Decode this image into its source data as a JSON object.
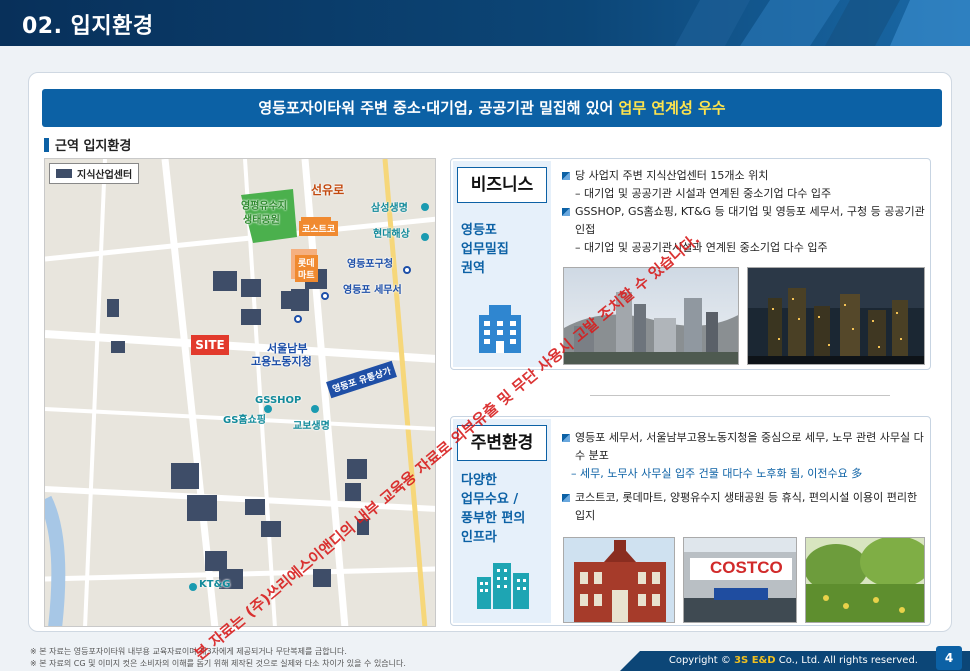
{
  "header": {
    "title": "02. 입지환경"
  },
  "banner": {
    "text_main": "영등포자이타워 주변 중소·대기업, 공공기관 밀집해 있어 ",
    "text_highlight": "업무 연계성 우수"
  },
  "section": {
    "label": "근역 입지환경"
  },
  "map": {
    "legend_label": "지식산업센터",
    "site_label": "SITE",
    "road_label": "영등포 유통상가",
    "labels": [
      {
        "text": "영평유수지",
        "style": "green"
      },
      {
        "text": "생태공원",
        "style": "green"
      },
      {
        "text": "선유로",
        "style": "orange"
      },
      {
        "text": "코스트코",
        "style": "orange"
      },
      {
        "text": "롯데",
        "style": "orange"
      },
      {
        "text": "마트",
        "style": "orange"
      },
      {
        "text": "삼성생명",
        "style": "teal"
      },
      {
        "text": "현대해상",
        "style": "teal"
      },
      {
        "text": "영등포구청",
        "style": "blue"
      },
      {
        "text": "영등포 세무서",
        "style": "blue"
      },
      {
        "text": "서울남부",
        "style": "blue"
      },
      {
        "text": "고용노동지청",
        "style": "blue"
      },
      {
        "text": "GSSHOP",
        "style": "teal"
      },
      {
        "text": "GS홈쇼핑",
        "style": "teal"
      },
      {
        "text": "교보생명",
        "style": "teal"
      },
      {
        "text": "KT&G",
        "style": "teal"
      }
    ]
  },
  "business": {
    "title": "비즈니스",
    "subtitle_lines": [
      "영등포",
      "업무밀집",
      "권역"
    ],
    "bullets": [
      {
        "type": "main",
        "text": "당 사업지 주변 지식산업센터 15개소 위치"
      },
      {
        "type": "sub",
        "text": "– 대기업 및 공공기관 시설과 연계된 중소기업 다수 입주"
      },
      {
        "type": "main",
        "text": "GSSHOP, GS홈쇼핑, KT&G 등 대기업 및 영등포 세무서, 구청 등 공공기관 인접"
      },
      {
        "type": "sub",
        "text": "– 대기업 및 공공기관시설과 연계된 중소기업 다수 입주"
      }
    ]
  },
  "environment": {
    "title": "주변환경",
    "subtitle_lines": [
      "다양한",
      "업무수요 /",
      "풍부한 편의",
      "인프라"
    ],
    "bullets": [
      {
        "type": "main",
        "text": "영등포 세무서, 서울남부고용노동지청을 중심으로 세무, 노무 관련 사무실 다수 분포"
      },
      {
        "type": "sub-blue",
        "text": "– 세무, 노무사 사무실 입주 건물 대다수 노후화 됨, 이전수요 多"
      },
      {
        "type": "main",
        "text": "코스트코, 롯데마트, 양평유수지 생태공원 등 휴식, 편의시설 이용이 편리한 입지"
      }
    ],
    "costco_sign": "COSTCO"
  },
  "footer": {
    "note1": "※ 본 자료는 영등포자이타워 내부용 교육자료이며 제3자에게 제공되거나 무단복제를 금합니다.",
    "note2": "※ 본 자료의 CG 및 이미지 컷은 소비자의 이해를 돕기 위해 제작된 것으로 실제와 다소 차이가 있을 수 있습니다.",
    "copyright_prefix": "Copyright © ",
    "copyright_brand": "3S E&D",
    "copyright_suffix": " Co., Ltd. All rights reserved.",
    "page": "4"
  },
  "watermark": {
    "line1": "본 자료는 (주)쓰리에스이앤디의 내부 교육용 자료로 외부유출 및 무단 사용시 고발 조치할 수 있습니다."
  },
  "colors": {
    "primary": "#0c61a5",
    "header": "#0c4677",
    "highlight": "#ffe44d",
    "site": "#e23a2c",
    "watermark": "#d81e1e"
  }
}
